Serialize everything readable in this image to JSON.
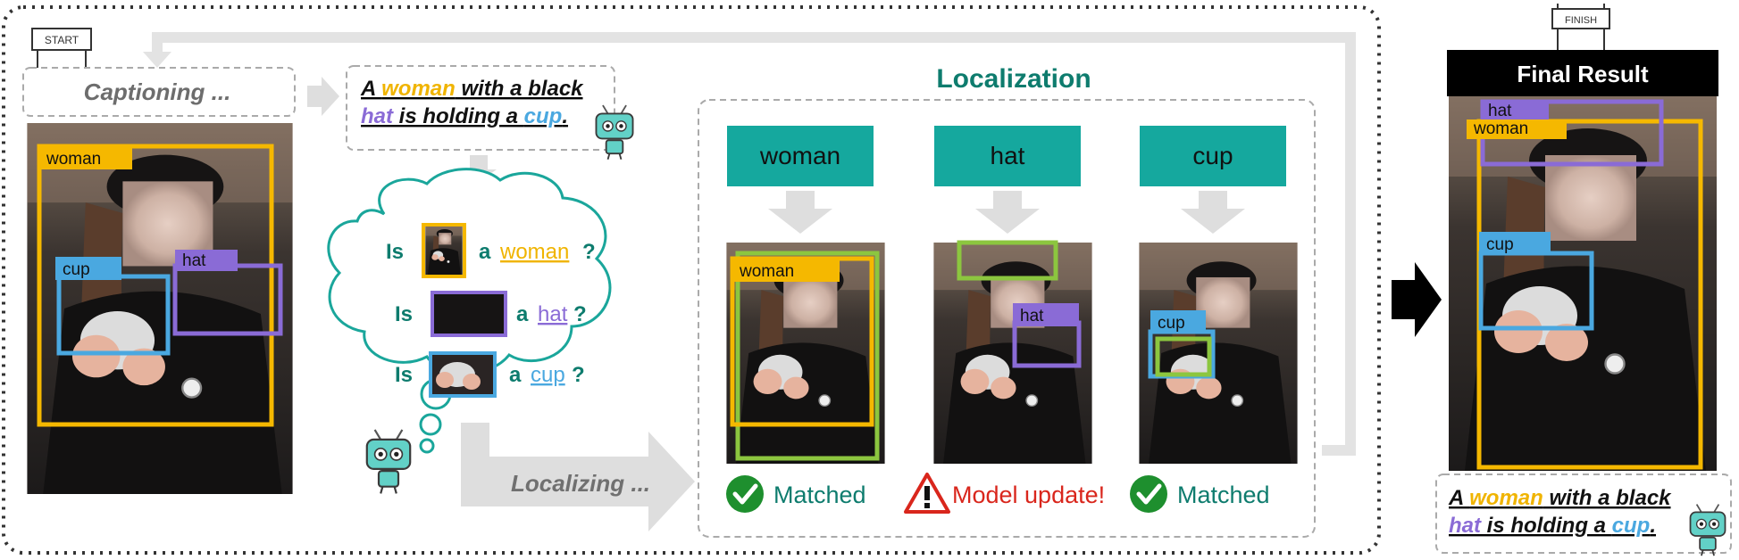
{
  "flags": {
    "start": "START",
    "finish": "FINISH"
  },
  "captioning": {
    "label": "Captioning ..."
  },
  "caption": {
    "line1": [
      {
        "text": "A ",
        "color": "#111111"
      },
      {
        "text": "woman",
        "color": "#f0b400"
      },
      {
        "text": " with a black",
        "color": "#111111"
      }
    ],
    "line2": [
      {
        "text": "hat",
        "color": "#8a6bd6"
      },
      {
        "text": " is holding a ",
        "color": "#111111"
      },
      {
        "text": "cup",
        "color": "#4aa8e0"
      },
      {
        "text": ".",
        "color": "#111111"
      }
    ]
  },
  "input_boxes": {
    "woman": "woman",
    "cup": "cup",
    "hat": "hat"
  },
  "thought": {
    "q1": {
      "prefix": "Is",
      "mid": "a",
      "word": "woman",
      "suffix": "?",
      "color": "#f0b400"
    },
    "q2": {
      "prefix": "Is",
      "mid": "a",
      "word": "hat",
      "suffix": "?",
      "color": "#8a6bd6"
    },
    "q3": {
      "prefix": "Is",
      "mid": "a",
      "word": "cup",
      "suffix": "?",
      "color": "#4aa8e0"
    }
  },
  "localizing": {
    "label": "Localizing ..."
  },
  "localization": {
    "title": "Localization",
    "headers": [
      "woman",
      "hat",
      "cup"
    ],
    "panel_labels": {
      "woman": "woman",
      "hat": "hat",
      "cup": "cup"
    },
    "status": [
      {
        "text": "Matched",
        "icon": "check-icon",
        "color": "#0e7c6e"
      },
      {
        "text": "Model update!",
        "icon": "warning-icon",
        "color": "#d9261c"
      },
      {
        "text": "Matched",
        "icon": "check-icon",
        "color": "#0e7c6e"
      }
    ]
  },
  "final": {
    "title": "Final Result",
    "labels": {
      "hat": "hat",
      "woman": "woman",
      "cup": "cup"
    }
  },
  "colors": {
    "woman": "#f5b800",
    "hat": "#8a6bd6",
    "cup": "#4aa8e0",
    "matched_box": "#8cc63f",
    "teal": "#15a89e",
    "teal_dark": "#0e7c6e",
    "gray_arrow": "#dedede"
  }
}
